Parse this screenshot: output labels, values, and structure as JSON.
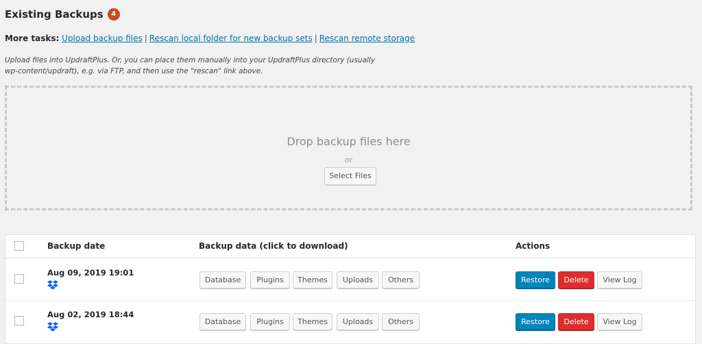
{
  "header": {
    "title": "Existing Backups",
    "count": "4"
  },
  "more_tasks": {
    "label": "More tasks:",
    "links": [
      "Upload backup files",
      "Rescan local folder for new backup sets",
      "Rescan remote storage"
    ],
    "separator": "|"
  },
  "hint": "Upload files into UpdraftPlus. Or, you can place them manually into your UpdraftPlus directory (usually wp-content/updraft), e.g. via FTP, and then use the \"rescan\" link above.",
  "dropzone": {
    "text": "Drop backup files here",
    "or": "or",
    "button": "Select Files"
  },
  "table": {
    "headers": {
      "date": "Backup date",
      "data": "Backup data (click to download)",
      "actions": "Actions"
    },
    "rows": [
      {
        "date": "Aug 09, 2019 19:01",
        "storage_icon": "dropbox-icon",
        "data_buttons": [
          "Database",
          "Plugins",
          "Themes",
          "Uploads",
          "Others"
        ],
        "actions": [
          "Restore",
          "Delete",
          "View Log"
        ]
      },
      {
        "date": "Aug 02, 2019 18:44",
        "storage_icon": "dropbox-icon",
        "data_buttons": [
          "Database",
          "Plugins",
          "Themes",
          "Uploads",
          "Others"
        ],
        "actions": [
          "Restore",
          "Delete",
          "View Log"
        ]
      }
    ]
  },
  "colors": {
    "link": "#0073aa",
    "badge": "#ca4a1f",
    "restore": "#0085ba",
    "delete": "#dd2e2e",
    "dropbox": "#0061fe"
  }
}
